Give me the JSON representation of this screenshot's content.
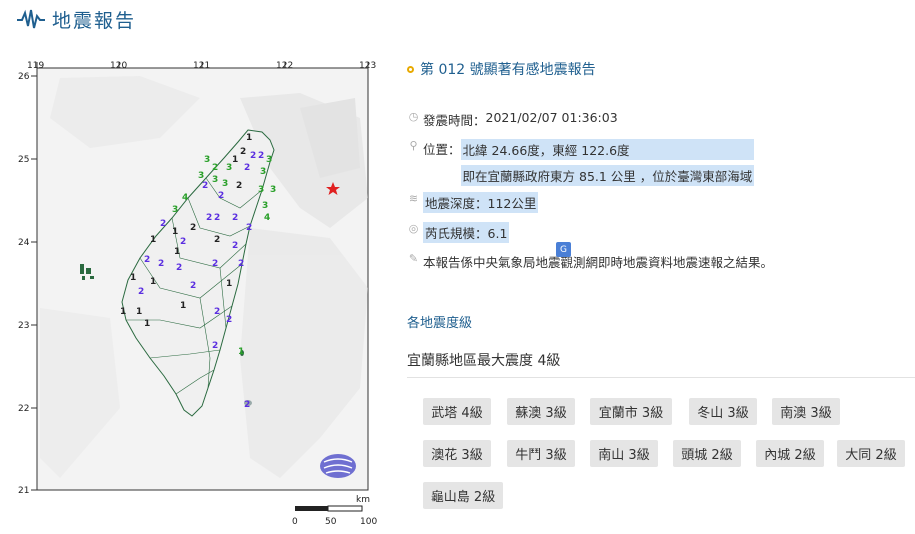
{
  "header": {
    "title": "地震報告"
  },
  "map": {
    "x_ticks": [
      "119",
      "120",
      "121",
      "122",
      "123"
    ],
    "y_ticks": [
      "26",
      "25",
      "24",
      "23",
      "22",
      "21"
    ],
    "scale_unit": "km",
    "scale_labels": [
      "0",
      "50",
      "100"
    ],
    "epicenter_color": "#e02020"
  },
  "report": {
    "title": "第 012 號顯著有感地震報告",
    "time_label": "發震時間：",
    "time_value": "2021/02/07 01:36:03",
    "location_label": "位置：",
    "location_line1": "北緯 24.66度，東經 122.6度",
    "location_line2": "即在宜蘭縣政府東方 85.1 公里 ，位於臺灣東部海域",
    "depth_label": "地震深度：",
    "depth_value": "112公里",
    "magnitude_label": "芮氏規模：",
    "magnitude_value": "6.1",
    "note": "本報告係中央氣象局地震觀測網即時地震資料地震速報之結果。"
  },
  "intensity": {
    "section_title": "各地震度級",
    "max_text": "宜蘭縣地區最大震度 4級",
    "stations": [
      "武塔 4級",
      "蘇澳 3級",
      "宜蘭市 3級",
      "冬山 3級",
      "南澳 3級",
      "澳花 3級",
      "牛鬥 3級",
      "南山 3級",
      "頭城 2級",
      "內城 2級",
      "大同 2級",
      "龜山島 2級"
    ]
  }
}
